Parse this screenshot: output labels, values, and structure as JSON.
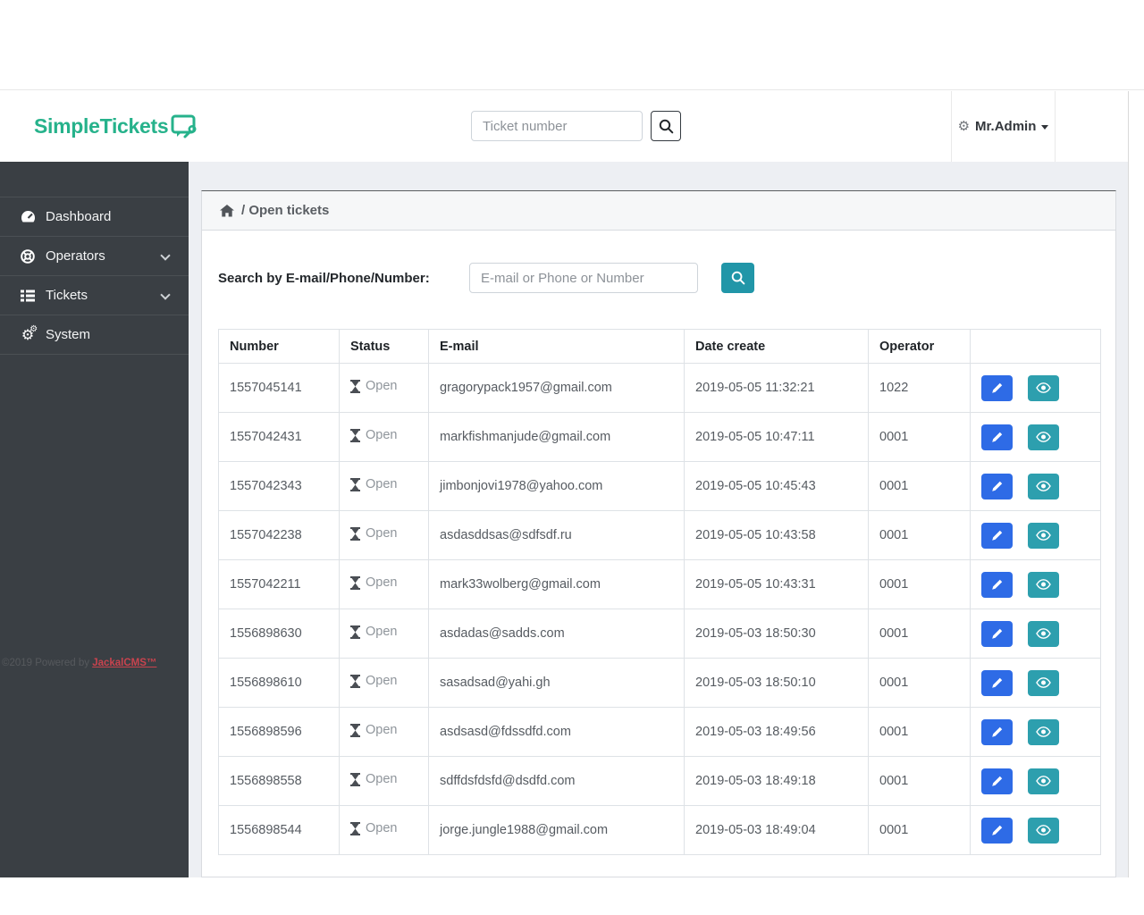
{
  "header": {
    "brand": "SimpleTickets",
    "search_placeholder": "Ticket number",
    "search_icon": "search-icon",
    "user": {
      "name": "Mr.Admin",
      "icon": "gear-icon",
      "caret": "caret-down-icon"
    }
  },
  "sidebar": {
    "items": [
      {
        "label": "Dashboard",
        "icon": "gauge-icon",
        "has_submenu": false
      },
      {
        "label": "Operators",
        "icon": "life-ring-icon",
        "has_submenu": true
      },
      {
        "label": "Tickets",
        "icon": "list-icon",
        "has_submenu": true
      },
      {
        "label": "System",
        "icon": "cogs-icon",
        "has_submenu": false
      }
    ],
    "footer": {
      "copyright": "©2019 Powered by",
      "link": "JackalCMS™"
    }
  },
  "breadcrumb": {
    "icon": "home-icon",
    "text": "/ Open tickets"
  },
  "search_panel": {
    "label": "Search by E-mail/Phone/Number:",
    "placeholder": "E-mail or Phone or Number",
    "button_icon": "search-icon"
  },
  "table": {
    "columns": [
      "Number",
      "Status",
      "E-mail",
      "Date create",
      "Operator",
      ""
    ],
    "row_actions": [
      "edit-pencil-icon",
      "view-eye-icon"
    ],
    "rows": [
      {
        "number": "1557045141",
        "status": "Open",
        "email": "gragorypack1957@gmail.com",
        "date": "2019-05-05 11:32:21",
        "operator": "1022"
      },
      {
        "number": "1557042431",
        "status": "Open",
        "email": "markfishmanjude@gmail.com",
        "date": "2019-05-05 10:47:11",
        "operator": "0001"
      },
      {
        "number": "1557042343",
        "status": "Open",
        "email": "jimbonjovi1978@yahoo.com",
        "date": "2019-05-05 10:45:43",
        "operator": "0001"
      },
      {
        "number": "1557042238",
        "status": "Open",
        "email": "asdasddsas@sdfsdf.ru",
        "date": "2019-05-05 10:43:58",
        "operator": "0001"
      },
      {
        "number": "1557042211",
        "status": "Open",
        "email": "mark33wolberg@gmail.com",
        "date": "2019-05-05 10:43:31",
        "operator": "0001"
      },
      {
        "number": "1556898630",
        "status": "Open",
        "email": "asdadas@sadds.com",
        "date": "2019-05-03 18:50:30",
        "operator": "0001"
      },
      {
        "number": "1556898610",
        "status": "Open",
        "email": "sasadsad@yahi.gh",
        "date": "2019-05-03 18:50:10",
        "operator": "0001"
      },
      {
        "number": "1556898596",
        "status": "Open",
        "email": "asdsasd@fdssdfd.com",
        "date": "2019-05-03 18:49:56",
        "operator": "0001"
      },
      {
        "number": "1556898558",
        "status": "Open",
        "email": "sdffdsfdsfd@dsdfd.com",
        "date": "2019-05-03 18:49:18",
        "operator": "0001"
      },
      {
        "number": "1556898544",
        "status": "Open",
        "email": "jorge.jungle1988@gmail.com",
        "date": "2019-05-03 18:49:04",
        "operator": "0001"
      }
    ]
  },
  "colors": {
    "brand_teal": "#26b28b",
    "sidebar_bg": "#3a3f44",
    "content_bg": "#edeff3",
    "edit_button_blue": "#2e6be6",
    "view_button_teal": "#2d9fae",
    "search_button_teal": "#2196a8",
    "cms_link_red": "#c9434e",
    "open_status_gray": "#8f959b"
  }
}
